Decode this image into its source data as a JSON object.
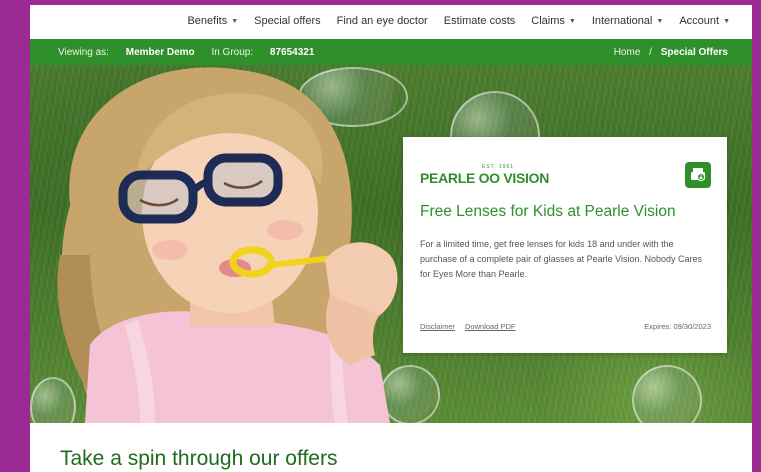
{
  "topnav": {
    "items": [
      {
        "label": "Benefits",
        "has_caret": true
      },
      {
        "label": "Special offers",
        "has_caret": false
      },
      {
        "label": "Find an eye doctor",
        "has_caret": false
      },
      {
        "label": "Estimate costs",
        "has_caret": false
      },
      {
        "label": "Claims",
        "has_caret": true
      },
      {
        "label": "International",
        "has_caret": true
      },
      {
        "label": "Account",
        "has_caret": true
      }
    ],
    "caret_glyph": "▼"
  },
  "member_bar": {
    "viewing_as_label": "Viewing as:",
    "member_name": "Member Demo",
    "group_label": "In Group:",
    "group_number": "87654321",
    "breadcrumb_home": "Home",
    "breadcrumb_sep": "/",
    "breadcrumb_current": "Special Offers",
    "color": "#2f8f2b"
  },
  "offer": {
    "brand_est": "EST. 1961",
    "brand_name": "PEARLE OO VISION",
    "icon": "printer-download-icon",
    "title": "Free Lenses for Kids at Pearle Vision",
    "description": "For a limited time, get free lenses for kids 18 and under with the purchase of a complete pair of glasses at Pearle Vision. Nobody Cares for Eyes More than Pearle.",
    "disclaimer_link": "Disclaimer",
    "download_link": "Download PDF",
    "expires": "Expires: 09/30/2023"
  },
  "section": {
    "title": "Take a spin through our offers"
  },
  "colors": {
    "frame": "#9b2a94",
    "accent_green": "#2f8f2b",
    "heading_green": "#1f6b1f"
  }
}
